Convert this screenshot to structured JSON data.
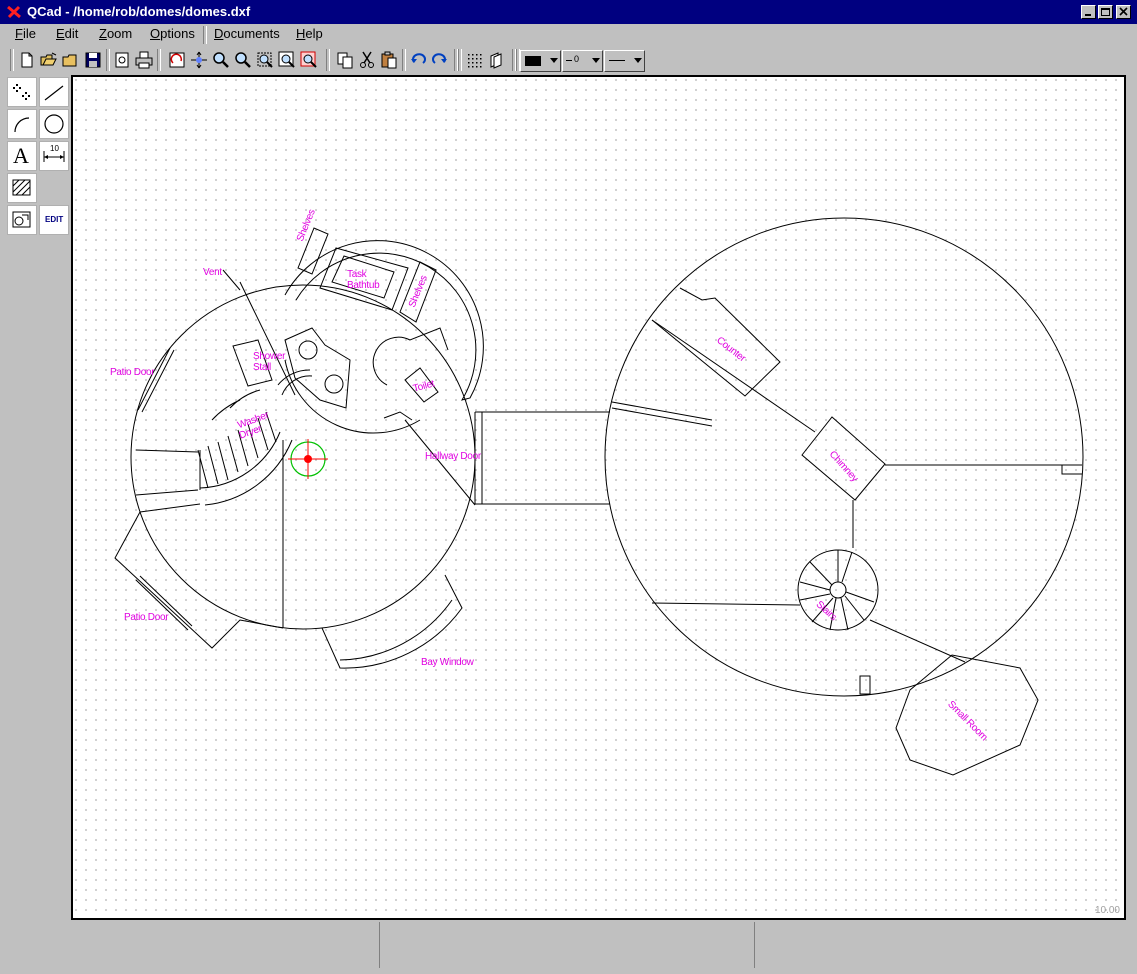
{
  "window": {
    "title": "QCad - /home/rob/domes/domes.dxf"
  },
  "menubar": {
    "items": [
      {
        "underline": "F",
        "rest": "ile"
      },
      {
        "underline": "E",
        "rest": "dit"
      },
      {
        "underline": "Z",
        "rest": "oom"
      },
      {
        "underline": "O",
        "rest": "ptions"
      },
      {
        "underline": "D",
        "rest": "ocuments"
      },
      {
        "underline": "H",
        "rest": "elp"
      }
    ]
  },
  "toolbar": {
    "icons": [
      "new-file-icon",
      "open-file-icon",
      "open-folder-icon",
      "save-icon",
      "print-preview-icon",
      "print-icon",
      "redraw-icon",
      "zoom-auto-icon",
      "zoom-in-icon",
      "zoom-out-icon",
      "zoom-window-icon",
      "zoom-previous-icon",
      "zoom-pan-icon",
      "copy-icon",
      "cut-icon",
      "paste-icon",
      "undo-icon",
      "redo-icon",
      "grid-icon",
      "layers-icon"
    ],
    "color_combo": {
      "selected": "#000000"
    },
    "width_combo": {
      "selected_text": "0"
    },
    "style_combo": {
      "selected_style": "solid-line"
    }
  },
  "tools": {
    "items": [
      "point-tool-icon",
      "line-tool-icon",
      "arc-tool-icon",
      "circle-tool-icon",
      "text-tool-icon",
      "dimension-tool-icon",
      "hatch-tool-icon",
      "image-tool-icon",
      "edit-tool-button"
    ],
    "edit_label": "EDIT",
    "text_glyph": "A",
    "dimension_glyph": "10"
  },
  "drawing": {
    "labels": {
      "vent": "Vent",
      "shelves_left": "Shelves",
      "task_bathtub_1": "Task",
      "task_bathtub_2": "Bathtub",
      "shelves_right": "Shelves",
      "patio_door_top": "Patio Door",
      "shower_stall_1": "Shower",
      "shower_stall_2": "Stall",
      "washer_1": "Washer",
      "washer_2": "Dryer",
      "toilet": "Toilet",
      "hallway_door": "Hallway Door",
      "patio_door_bottom": "Patio Door",
      "bay_window": "Bay Window",
      "counter": "Counter",
      "chimney": "Chimney",
      "stairs": "Stairs",
      "small_room": "Small Room"
    },
    "scale_text": "10.00",
    "line_color": "#000000",
    "label_color": "#e000e0",
    "crosshair_color": "#00c000",
    "crosshair_center_color": "#ff0000"
  },
  "statusbar": {
    "panel_1": "",
    "panel_2": "",
    "panel_3": ""
  }
}
